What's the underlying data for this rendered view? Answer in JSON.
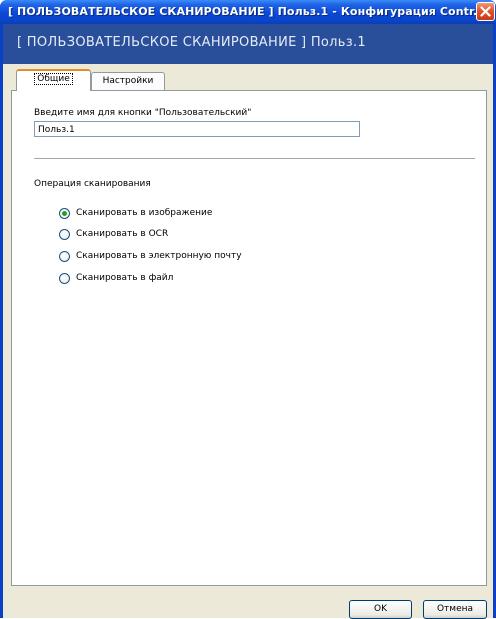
{
  "window": {
    "title": "[ ПОЛЬЗОВАТЕЛЬСКОЕ СКАНИРОВАНИЕ ]  Польз.1 - Конфигурация Contr..."
  },
  "banner": {
    "text": "[ ПОЛЬЗОВАТЕЛЬСКОЕ СКАНИРОВАНИЕ ]  Польз.1"
  },
  "tabs": [
    {
      "label": "Общие",
      "active": true
    },
    {
      "label": "Настройки",
      "active": false
    }
  ],
  "general": {
    "name_label": "Введите имя для кнопки \"Пользовательский\"",
    "name_value": "Польз.1",
    "operation_label": "Операция сканирования",
    "options": [
      {
        "label": "Сканировать в изображение",
        "checked": true
      },
      {
        "label": "Сканировать в OCR",
        "checked": false
      },
      {
        "label": "Сканировать в электронную почту",
        "checked": false
      },
      {
        "label": "Сканировать в файл",
        "checked": false
      }
    ]
  },
  "buttons": {
    "ok": "OK",
    "cancel": "Отмена"
  },
  "colors": {
    "title_bar": "#0a44cb",
    "banner": "#2a4f9a",
    "window_bg": "#ece9d8",
    "radio_checked": "#21a121",
    "active_tab_accent": "#e68b2c"
  }
}
